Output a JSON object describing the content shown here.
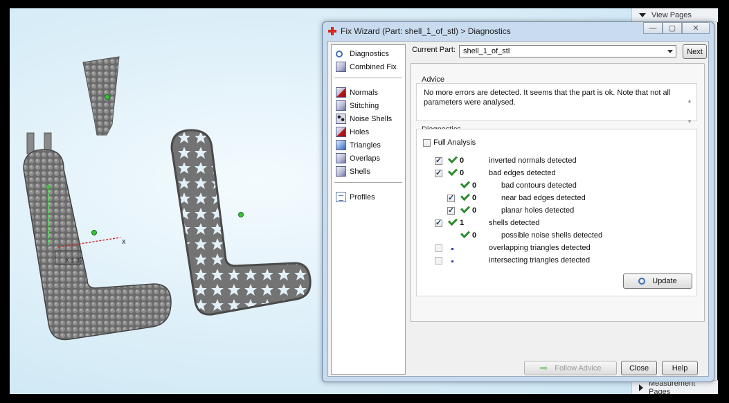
{
  "window": {
    "title": "Fix Wizard (Part: shell_1_of_stl) > Diagnostics",
    "buttons": {
      "minimize": "—",
      "maximize": "▢",
      "close": "✕"
    }
  },
  "side_panel": {
    "top_label": "View Pages",
    "bottom_label": "Measurement Pages"
  },
  "nav": {
    "items": [
      {
        "label": "Diagnostics",
        "icon": "magnifier-icon"
      },
      {
        "label": "Combined Fix",
        "icon": "combined-fix-icon"
      },
      {
        "label": "Normals",
        "icon": "normals-icon"
      },
      {
        "label": "Stitching",
        "icon": "stitching-icon"
      },
      {
        "label": "Noise Shells",
        "icon": "noise-shells-icon"
      },
      {
        "label": "Holes",
        "icon": "holes-icon"
      },
      {
        "label": "Triangles",
        "icon": "triangles-icon"
      },
      {
        "label": "Overlaps",
        "icon": "overlaps-icon"
      },
      {
        "label": "Shells",
        "icon": "shells-icon"
      },
      {
        "label": "Profiles",
        "icon": "profiles-icon"
      }
    ]
  },
  "current_part": {
    "label": "Current Part:",
    "value": "shell_1_of_stl",
    "next_label": "Next"
  },
  "advice": {
    "title": "Advice",
    "text": "No more errors are detected. It seems that the part is ok. Note that not all parameters were analysed."
  },
  "diagnostics": {
    "title": "Diagnostics",
    "full_analysis_label": "Full Analysis",
    "full_analysis_checked": false,
    "rows": [
      {
        "label": "inverted normals detected",
        "count": "0",
        "checked": true,
        "status": "ok",
        "level": 0
      },
      {
        "label": "bad edges detected",
        "count": "0",
        "checked": true,
        "status": "ok",
        "level": 0
      },
      {
        "label": "bad contours detected",
        "count": "0",
        "checked": null,
        "status": "ok",
        "level": 1
      },
      {
        "label": "near bad edges detected",
        "count": "0",
        "checked": true,
        "status": "ok",
        "level": 1
      },
      {
        "label": "planar holes detected",
        "count": "0",
        "checked": true,
        "status": "ok",
        "level": 1
      },
      {
        "label": "shells detected",
        "count": "1",
        "checked": true,
        "status": "ok",
        "level": 0
      },
      {
        "label": "possible noise shells detected",
        "count": "0",
        "checked": null,
        "status": "ok",
        "level": 1
      },
      {
        "label": "overlapping triangles detected",
        "count": "",
        "checked": false,
        "status": "pending",
        "level": 0
      },
      {
        "label": "intersecting triangles detected",
        "count": "",
        "checked": false,
        "status": "pending",
        "level": 0
      }
    ],
    "update_label": "Update"
  },
  "footer": {
    "follow_advice_label": "Follow Advice",
    "close_label": "Close",
    "help_label": "Help"
  },
  "viewport": {
    "axis_label_x": "x",
    "coord_readout": "X 1.37"
  },
  "colors": {
    "ok_check": "#2e8c2e",
    "pending_dot": "#2a3fae",
    "dialog_frame": "#c9dcef",
    "viewport_bg": "#dff0f9"
  }
}
